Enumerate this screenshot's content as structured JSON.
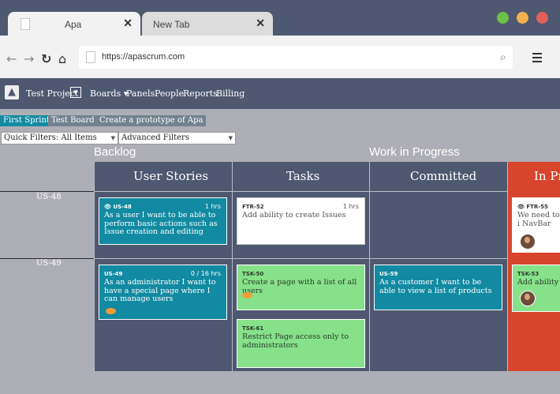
{
  "browser": {
    "tabs": [
      {
        "label": "Apa"
      },
      {
        "label": "New Tab"
      }
    ],
    "url": "https://apascrum.com",
    "window_controls": {
      "colors": [
        "#6cc04a",
        "#f2b14f",
        "#e3605c"
      ]
    }
  },
  "app": {
    "logo": "▲",
    "project": "Test Project",
    "nav": [
      {
        "label": "Boards ▾"
      },
      {
        "label": "Panels"
      },
      {
        "label": "People"
      },
      {
        "label": "Reports"
      },
      {
        "label": "Billing"
      }
    ],
    "board_tabs": [
      {
        "label": "First Sprint"
      },
      {
        "label": "Test Board"
      },
      {
        "label": "Create a prototype of Apa"
      }
    ],
    "filters": {
      "quick": "Quick Filters: All Items",
      "advanced": "Advanced Filters"
    }
  },
  "board": {
    "sections": {
      "backlog": "Backlog",
      "wip": "Work in Progress"
    },
    "columns": [
      {
        "label": "User Stories"
      },
      {
        "label": "Tasks"
      },
      {
        "label": "Committed"
      },
      {
        "label": "In Pro"
      }
    ],
    "rows": [
      {
        "label": "US-48"
      },
      {
        "label": "US-49"
      }
    ],
    "cards": [
      {
        "id": "US-48",
        "hours": "1 hrs",
        "text": "As a user I want to be able to perform basic actions such as Issue creation and editing",
        "watched": true
      },
      {
        "id": "FTR-52",
        "hours": "1 hrs",
        "text": "Add ability to create Issues"
      },
      {
        "id": "FTR-55",
        "text": "We need to i NavBar",
        "watched": true
      },
      {
        "id": "US-49",
        "hours": "0 / 16 hrs",
        "text": "As an administrator I want to have a special page where I can manage users"
      },
      {
        "id": "TSK-50",
        "text": "Create a page with a list of all users"
      },
      {
        "id": "US-59",
        "text": "As a customer I want to be able to view a list of products"
      },
      {
        "id": "TSK-53",
        "text": "Add ability to"
      },
      {
        "id": "TSK-61",
        "text": "Restrict Page access only to administrators"
      }
    ]
  }
}
